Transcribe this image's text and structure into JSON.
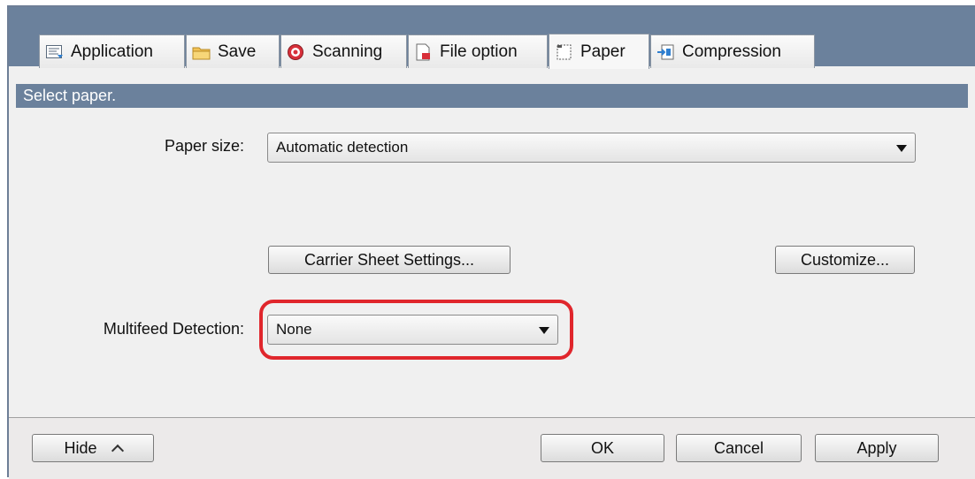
{
  "tabs": [
    {
      "label": "Application",
      "icon": "application-icon"
    },
    {
      "label": "Save",
      "icon": "folder-icon"
    },
    {
      "label": "Scanning",
      "icon": "scanning-icon"
    },
    {
      "label": "File option",
      "icon": "file-icon"
    },
    {
      "label": "Paper",
      "icon": "paper-icon",
      "active": true
    },
    {
      "label": "Compression",
      "icon": "compression-icon"
    }
  ],
  "banner": {
    "text": "Select paper."
  },
  "paper_size": {
    "label": "Paper size:",
    "value": "Automatic detection"
  },
  "buttons": {
    "carrier": "Carrier Sheet Settings...",
    "customize": "Customize...",
    "hide": "Hide",
    "ok": "OK",
    "cancel": "Cancel",
    "apply": "Apply"
  },
  "multifeed": {
    "label": "Multifeed Detection:",
    "value": "None"
  },
  "colors": {
    "header": "#6b819c",
    "highlight": "#e0262c"
  }
}
